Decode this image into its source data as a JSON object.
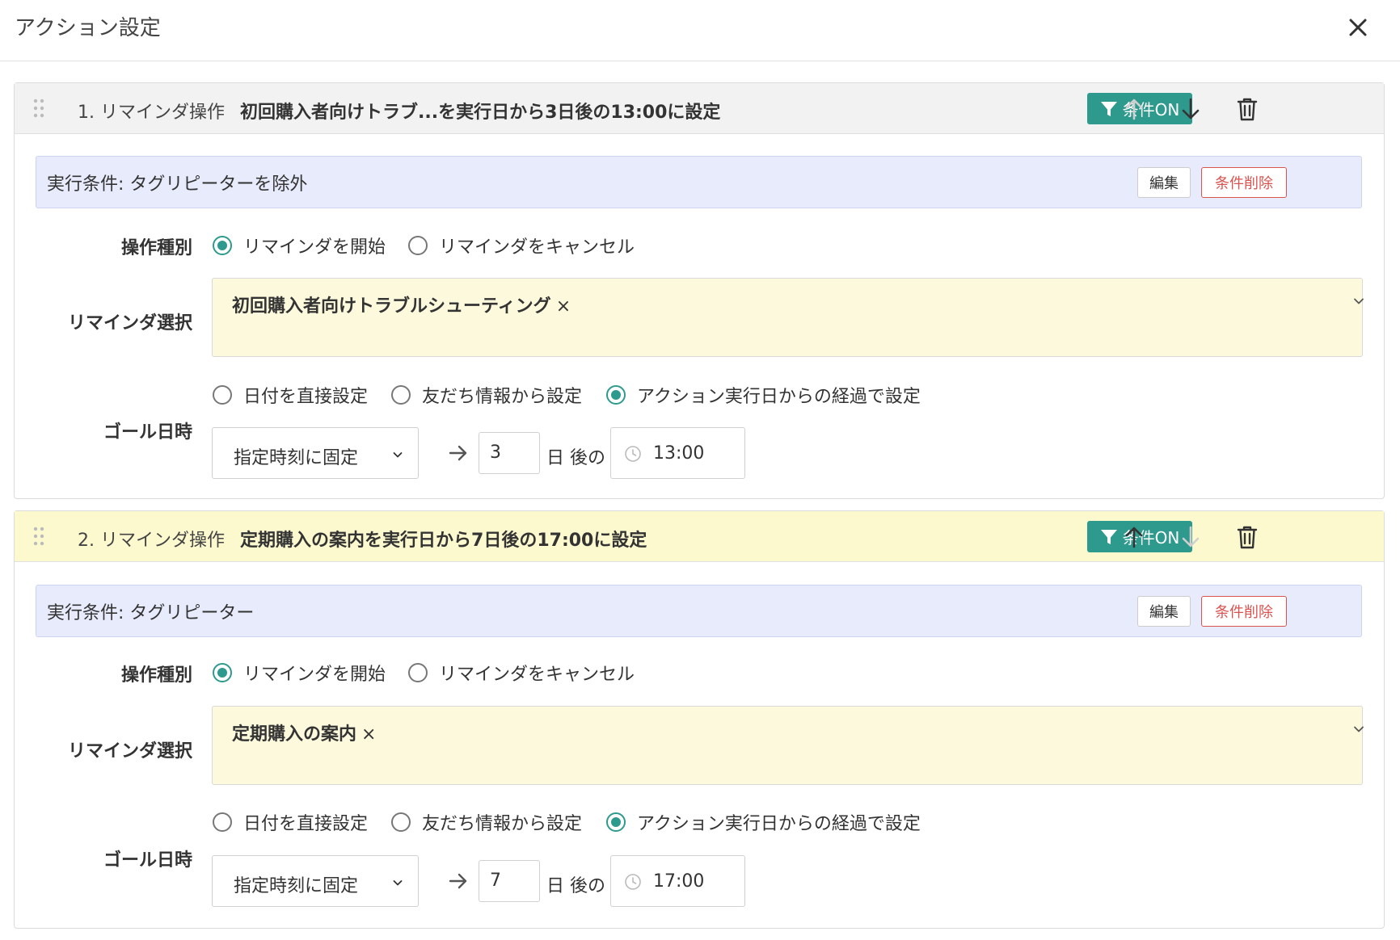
{
  "modal": {
    "title": "アクション設定"
  },
  "actions": [
    {
      "index": "1.",
      "type_label": "リマインダ操作",
      "summary": "初回購入者向けトラブ...を実行日から3日後の13:00に設定",
      "condition_on_label": "条件ON",
      "condition_text": "実行条件: タグリピーターを除外",
      "edit_label": "編集",
      "delete_condition_label": "条件削除",
      "op_type_label": "操作種別",
      "op_options": [
        "リマインダを開始",
        "リマインダをキャンセル"
      ],
      "op_selected": 0,
      "reminder_select_label": "リマインダ選択",
      "reminder_tag": "初回購入者向けトラブルシューティング",
      "goal_label": "ゴール日時",
      "goal_options": [
        "日付を直接設定",
        "友だち情報から設定",
        "アクション実行日からの経過で設定"
      ],
      "goal_selected": 2,
      "time_mode": "指定時刻に固定",
      "days": "3",
      "days_after_label": "日 後の",
      "time": "13:00"
    },
    {
      "index": "2.",
      "type_label": "リマインダ操作",
      "summary": "定期購入の案内を実行日から7日後の17:00に設定",
      "condition_on_label": "条件ON",
      "condition_text": "実行条件: タグリピーター",
      "edit_label": "編集",
      "delete_condition_label": "条件削除",
      "op_type_label": "操作種別",
      "op_options": [
        "リマインダを開始",
        "リマインダをキャンセル"
      ],
      "op_selected": 0,
      "reminder_select_label": "リマインダ選択",
      "reminder_tag": "定期購入の案内",
      "goal_label": "ゴール日時",
      "goal_options": [
        "日付を直接設定",
        "友だち情報から設定",
        "アクション実行日からの経過で設定"
      ],
      "goal_selected": 2,
      "time_mode": "指定時刻に固定",
      "days": "7",
      "days_after_label": "日 後の",
      "time": "17:00"
    }
  ],
  "colors": {
    "accent": "#2e9a8e",
    "danger": "#d9534f",
    "condition_bg": "#e7ebfb",
    "select_bg": "#fdf9dc"
  }
}
